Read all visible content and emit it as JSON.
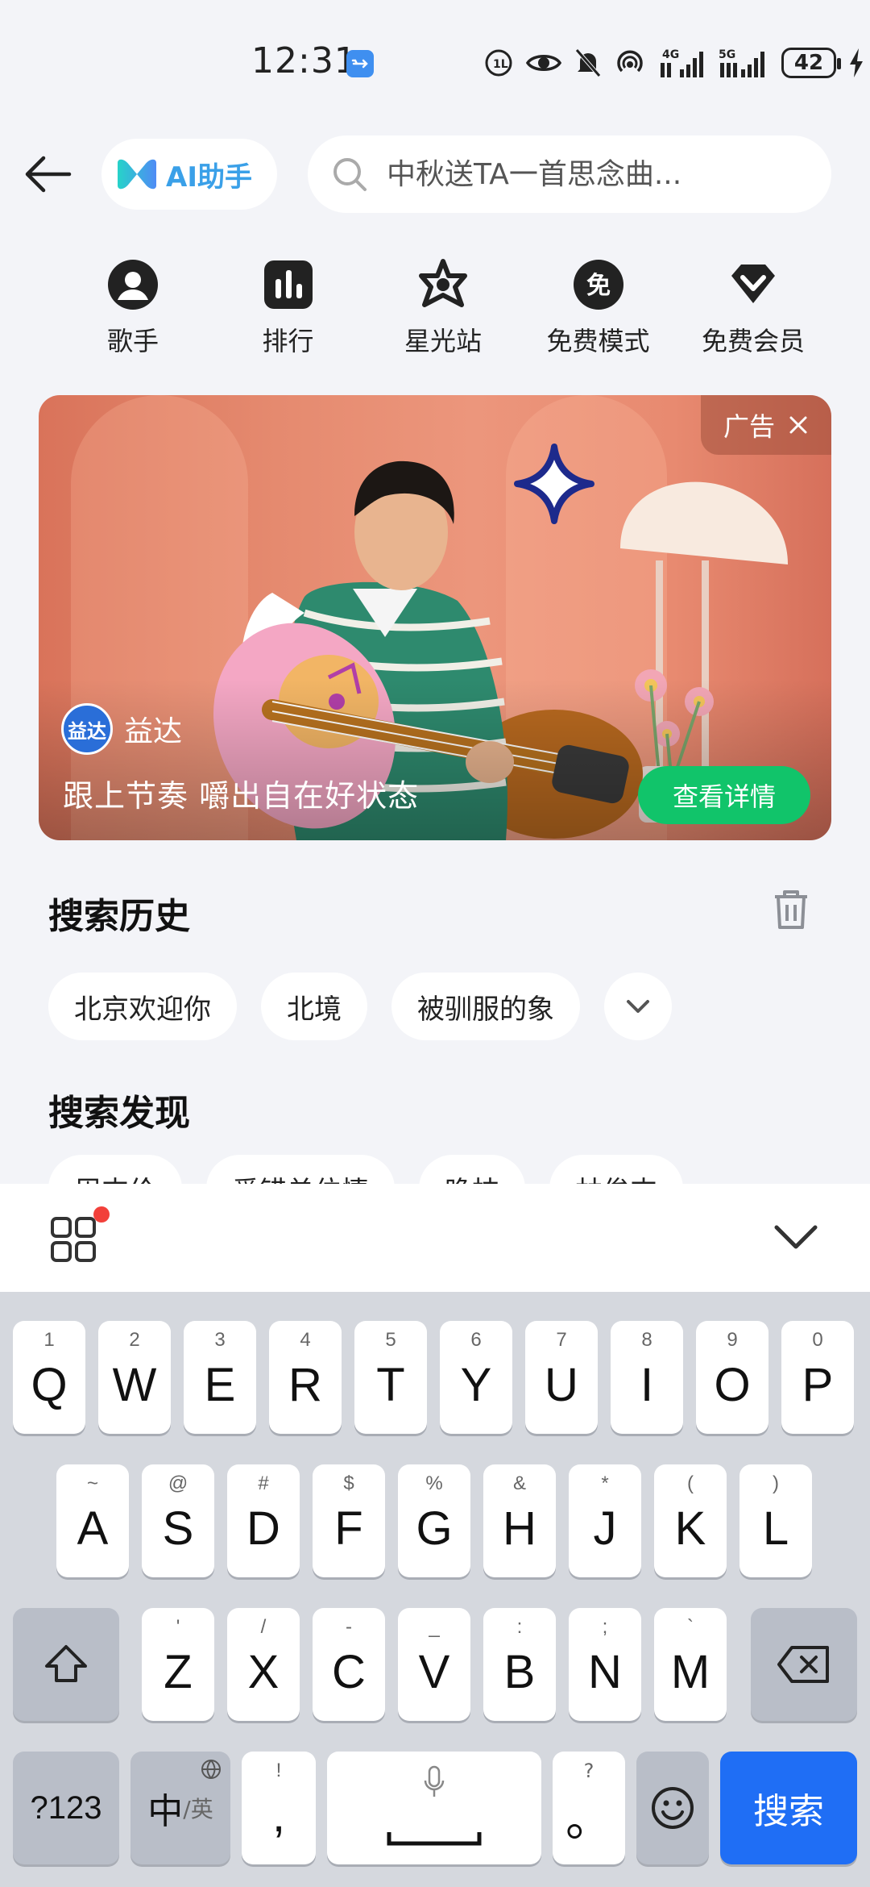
{
  "status_bar": {
    "time": "12:31",
    "battery": "42",
    "signal_1": "4G",
    "signal_2": "5G"
  },
  "header": {
    "ai_assistant_label": "AI助手",
    "search_placeholder": "中秋送TA一首思念曲..."
  },
  "quick_nav": [
    {
      "label": "歌手",
      "icon": "singer-icon"
    },
    {
      "label": "排行",
      "icon": "chart-icon"
    },
    {
      "label": "星光站",
      "icon": "star-station-icon"
    },
    {
      "label": "免费模式",
      "icon": "free-mode-icon"
    },
    {
      "label": "免费会员",
      "icon": "vip-diamond-icon"
    }
  ],
  "ad": {
    "tag": "广告",
    "brand_logo_text": "益达",
    "brand_name": "益达",
    "slogan": "跟上节奏 嚼出自在好状态",
    "detail_button": "查看详情"
  },
  "search_history": {
    "title": "搜索历史",
    "items": [
      "北京欢迎你",
      "北境",
      "被驯服的象"
    ]
  },
  "search_discover": {
    "title": "搜索发现",
    "items": [
      "周杰伦",
      "爱错单位情",
      "晚枝",
      "林俊杰"
    ]
  },
  "keyboard": {
    "row1": [
      {
        "hint": "1",
        "key": "Q"
      },
      {
        "hint": "2",
        "key": "W"
      },
      {
        "hint": "3",
        "key": "E"
      },
      {
        "hint": "4",
        "key": "R"
      },
      {
        "hint": "5",
        "key": "T"
      },
      {
        "hint": "6",
        "key": "Y"
      },
      {
        "hint": "7",
        "key": "U"
      },
      {
        "hint": "8",
        "key": "I"
      },
      {
        "hint": "9",
        "key": "O"
      },
      {
        "hint": "0",
        "key": "P"
      }
    ],
    "row2": [
      {
        "hint": "~",
        "key": "A"
      },
      {
        "hint": "@",
        "key": "S"
      },
      {
        "hint": "#",
        "key": "D"
      },
      {
        "hint": "$",
        "key": "F"
      },
      {
        "hint": "%",
        "key": "G"
      },
      {
        "hint": "&",
        "key": "H"
      },
      {
        "hint": "*",
        "key": "J"
      },
      {
        "hint": "(",
        "key": "K"
      },
      {
        "hint": ")",
        "key": "L"
      }
    ],
    "row3": [
      {
        "hint": "'",
        "key": "Z"
      },
      {
        "hint": "/",
        "key": "X"
      },
      {
        "hint": "-",
        "key": "C"
      },
      {
        "hint": "_",
        "key": "V"
      },
      {
        "hint": ":",
        "key": "B"
      },
      {
        "hint": ";",
        "key": "N"
      },
      {
        "hint": "`",
        "key": "M"
      }
    ],
    "num_key": "?123",
    "lang_main": "中",
    "lang_sub": "/英",
    "comma_hint": "!",
    "comma_key": ",",
    "period_hint": "?",
    "period_key": "。",
    "search_key": "搜索"
  }
}
